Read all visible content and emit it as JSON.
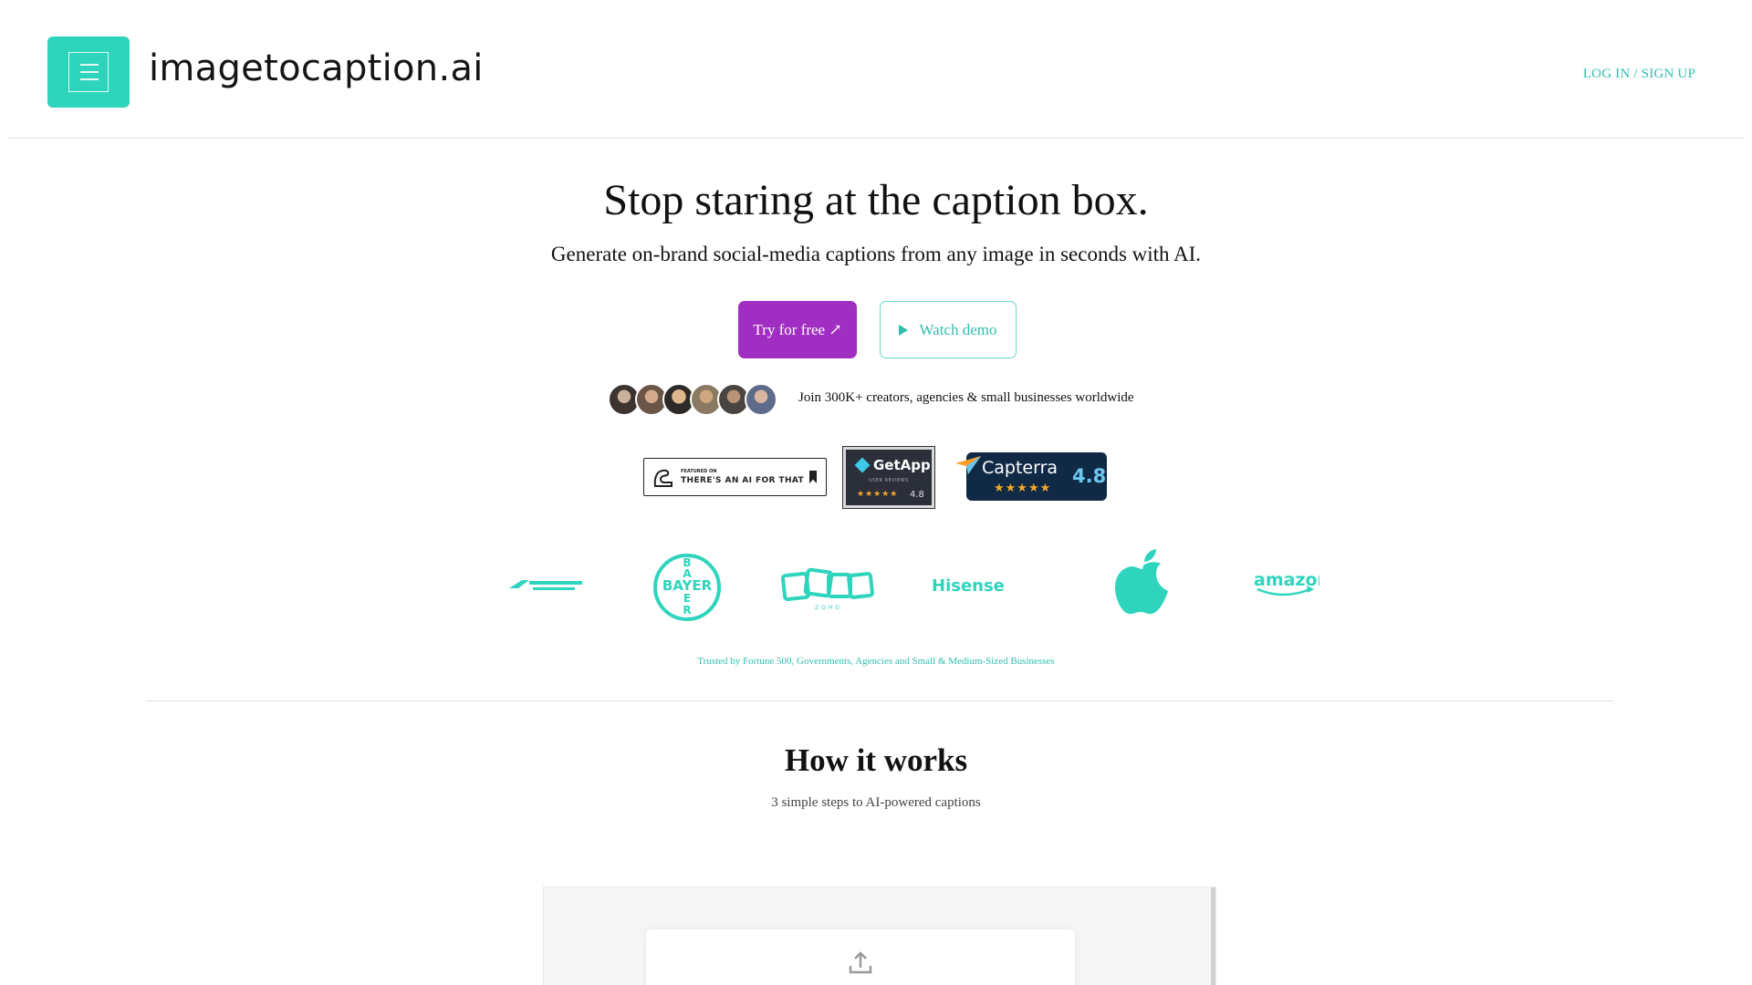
{
  "header": {
    "brand": "imagetocaption.ai",
    "login_label": "LOG IN / SIGN UP",
    "logo_icon": "menu-lines-icon"
  },
  "hero": {
    "title": "Stop staring at the caption box.",
    "subtitle": "Generate on-brand social-media captions from any image in seconds with AI.",
    "try_label": "Try for free ↗",
    "demo_label": "Watch demo",
    "join_text": "Join 300K+ creators, agencies & small businesses worldwide",
    "avatar_count": 6
  },
  "badges": {
    "aift_small": "FEATURED ON",
    "aift_big": "THERE'S AN AI FOR THAT",
    "getapp_name": "GetApp",
    "getapp_sub": "USER REVIEWS",
    "getapp_stars": "★★★★★",
    "getapp_rating": "4.8",
    "capterra_name": "Capterra",
    "capterra_stars": "★★★★★",
    "capterra_rating": "4.8"
  },
  "clients": {
    "logos": [
      "air-india-logo",
      "bayer-logo",
      "zoho-logo",
      "hisense-logo",
      "apple-logo",
      "amazon-logo"
    ],
    "bayer_text": "BAYER",
    "bayer_letters": [
      "B",
      "A",
      "E",
      "R"
    ],
    "zoho_text": "ZOHO",
    "hisense_text": "Hisense",
    "amazon_text": "amazon",
    "trusted_text": "Trusted by Fortune 500, Governments, Agencies and Small & Medium-Sized Businesses"
  },
  "how": {
    "title": "How it works",
    "subtitle": "3 simple steps to AI-powered captions"
  },
  "colors": {
    "accent": "#2fd4bd",
    "accent_text": "#2fbfae",
    "cta": "#a12ec2",
    "getapp_bg": "#2b2f3a",
    "capterra_bg": "#102a45"
  }
}
